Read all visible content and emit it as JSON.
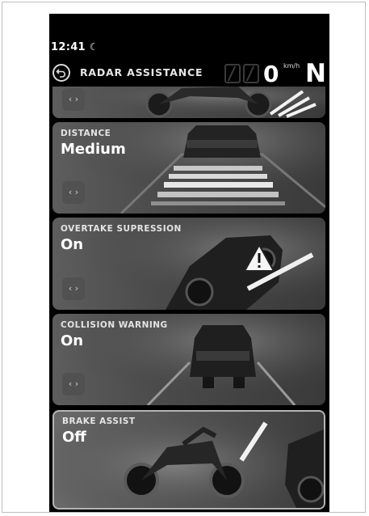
{
  "status_bar": {
    "time": "12:41",
    "moon_icon": "☾"
  },
  "header": {
    "title": "RADAR ASSISTANCE",
    "speed": "0",
    "unit": "km/h",
    "gear": "N"
  },
  "cards": [
    {
      "label": "",
      "value": "",
      "arrows": "‹ ›"
    },
    {
      "label": "DISTANCE",
      "value": "Medium",
      "arrows": "‹ ›"
    },
    {
      "label": "OVERTAKE SUPRESSION",
      "value": "On",
      "arrows": "‹ ›"
    },
    {
      "label": "COLLISION WARNING",
      "value": "On",
      "arrows": "‹ ›"
    },
    {
      "label": "BRAKE ASSIST",
      "value": "Off"
    }
  ]
}
